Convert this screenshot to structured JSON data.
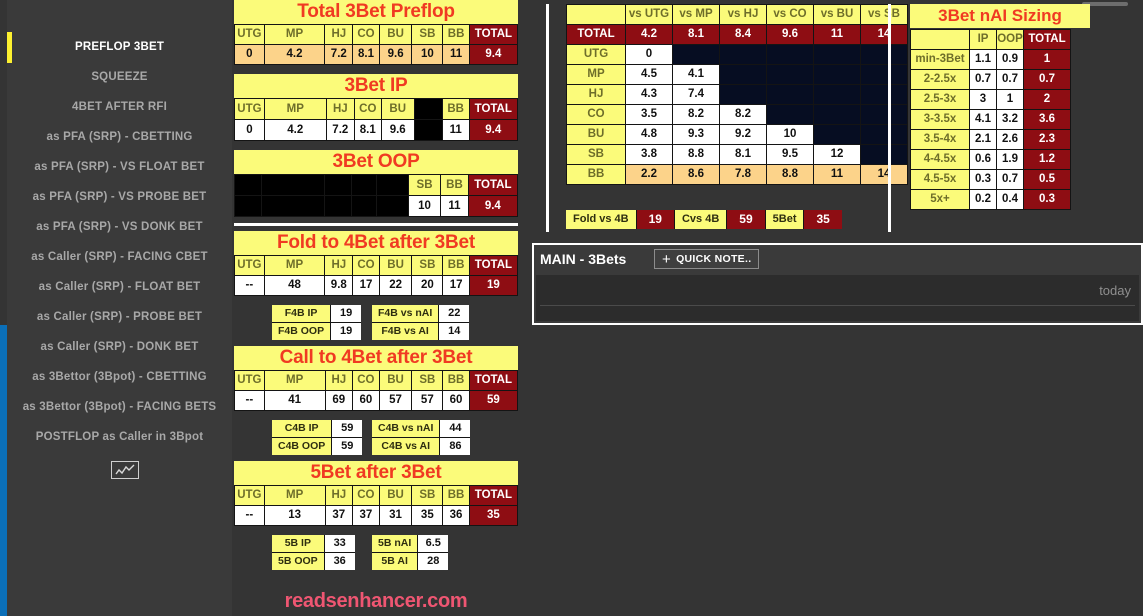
{
  "colors": {
    "accent_yellow": "#fbfb7a",
    "header_red": "#f03a22",
    "total_dark_red": "#8e0d13",
    "value_orange": "#fcd38a",
    "panel_bg": "#343434",
    "empty_navy": "#060d22",
    "brand_pink": "#ef5672",
    "sidebar_marker": "#fdf130"
  },
  "sidebar": {
    "items": [
      {
        "label": "PREFLOP 3BET",
        "active": true
      },
      {
        "label": "SQUEEZE",
        "active": false
      },
      {
        "label": "4BET AFTER RFI",
        "active": false
      },
      {
        "label": "as PFA (SRP) - CBETTING",
        "active": false
      },
      {
        "label": "as PFA (SRP) - VS FLOAT BET",
        "active": false
      },
      {
        "label": "as PFA (SRP) - VS PROBE BET",
        "active": false
      },
      {
        "label": "as PFA (SRP) - VS DONK BET",
        "active": false
      },
      {
        "label": "as Caller (SRP) - FACING CBET",
        "active": false
      },
      {
        "label": "as Caller (SRP) - FLOAT BET",
        "active": false
      },
      {
        "label": "as Caller (SRP) - PROBE BET",
        "active": false
      },
      {
        "label": "as Caller (SRP) - DONK BET",
        "active": false
      },
      {
        "label": "as 3Bettor (3Bpot) - CBETTING",
        "active": false
      },
      {
        "label": "as 3Bettor (3Bpot) - FACING BETS",
        "active": false
      },
      {
        "label": "POSTFLOP as Caller in 3Bpot",
        "active": false
      }
    ],
    "chart_icon": "line-chart-icon"
  },
  "positions": [
    "UTG",
    "MP",
    "HJ",
    "CO",
    "BU",
    "SB",
    "BB"
  ],
  "total_label": "TOTAL",
  "tables": {
    "total_3bet_preflop": {
      "title": "Total 3Bet Preflop",
      "headers": [
        "UTG",
        "MP",
        "HJ",
        "CO",
        "BU",
        "SB",
        "BB",
        "TOTAL"
      ],
      "values": [
        "0",
        "4.2",
        "7.2",
        "8.1",
        "9.6",
        "10",
        "11",
        "9.4"
      ]
    },
    "3bet_ip": {
      "title": "3Bet IP",
      "headers": [
        "UTG",
        "MP",
        "HJ",
        "CO",
        "BU",
        "",
        "BB",
        "TOTAL"
      ],
      "values": [
        "0",
        "4.2",
        "7.2",
        "8.1",
        "9.6",
        "",
        "11",
        "9.4"
      ]
    },
    "3bet_oop": {
      "title": "3Bet OOP",
      "headers": [
        "",
        "",
        "",
        "",
        "",
        "SB",
        "BB",
        "TOTAL"
      ],
      "values": [
        "",
        "",
        "",
        "",
        "",
        "10",
        "11",
        "9.4"
      ]
    },
    "fold_to_4bet": {
      "title": "Fold to 4Bet after 3Bet",
      "headers": [
        "UTG",
        "MP",
        "HJ",
        "CO",
        "BU",
        "SB",
        "BB",
        "TOTAL"
      ],
      "values": [
        "--",
        "48",
        "9.8",
        "17",
        "22",
        "20",
        "17",
        "19"
      ],
      "pills_left": [
        {
          "label": "F4B IP",
          "value": "19"
        },
        {
          "label": "F4B OOP",
          "value": "19"
        }
      ],
      "pills_right": [
        {
          "label": "F4B vs nAI",
          "value": "22"
        },
        {
          "label": "F4B vs AI",
          "value": "14"
        }
      ]
    },
    "call_to_4bet": {
      "title": "Call to 4Bet after 3Bet",
      "headers": [
        "UTG",
        "MP",
        "HJ",
        "CO",
        "BU",
        "SB",
        "BB",
        "TOTAL"
      ],
      "values": [
        "--",
        "41",
        "69",
        "60",
        "57",
        "57",
        "60",
        "59"
      ],
      "pills_left": [
        {
          "label": "C4B IP",
          "value": "59"
        },
        {
          "label": "C4B OOP",
          "value": "59"
        }
      ],
      "pills_right": [
        {
          "label": "C4B vs nAI",
          "value": "44"
        },
        {
          "label": "C4B vs AI",
          "value": "86"
        }
      ]
    },
    "5bet_after_3bet": {
      "title": "5Bet after 3Bet",
      "headers": [
        "UTG",
        "MP",
        "HJ",
        "CO",
        "BU",
        "SB",
        "BB",
        "TOTAL"
      ],
      "values": [
        "--",
        "13",
        "37",
        "37",
        "31",
        "35",
        "36",
        "35"
      ],
      "pills_left": [
        {
          "label": "5B IP",
          "value": "33"
        },
        {
          "label": "5B OOP",
          "value": "36"
        }
      ],
      "pills_right": [
        {
          "label": "5B nAI",
          "value": "6.5"
        },
        {
          "label": "5B AI",
          "value": "28"
        }
      ]
    }
  },
  "brand": "readsenhancer.com",
  "matrix": {
    "col_headers": [
      "vs UTG",
      "vs MP",
      "vs HJ",
      "vs CO",
      "vs BU",
      "vs SB"
    ],
    "total_row_label": "TOTAL",
    "total_row": [
      "4.2",
      "8.1",
      "8.4",
      "9.6",
      "11",
      "14"
    ],
    "rows": [
      {
        "label": "UTG",
        "values": [
          "0",
          "",
          "",
          "",
          "",
          ""
        ],
        "highlight": false
      },
      {
        "label": "MP",
        "values": [
          "4.5",
          "4.1",
          "",
          "",
          "",
          ""
        ],
        "highlight": false
      },
      {
        "label": "HJ",
        "values": [
          "4.3",
          "7.4",
          "",
          "",
          "",
          ""
        ],
        "highlight": false
      },
      {
        "label": "CO",
        "values": [
          "3.5",
          "8.2",
          "8.2",
          "",
          "",
          ""
        ],
        "highlight": false
      },
      {
        "label": "BU",
        "values": [
          "4.8",
          "9.3",
          "9.2",
          "10",
          "",
          ""
        ],
        "highlight": false
      },
      {
        "label": "SB",
        "values": [
          "3.8",
          "8.8",
          "8.1",
          "9.5",
          "12",
          ""
        ],
        "highlight": false
      },
      {
        "label": "BB",
        "values": [
          "2.2",
          "8.6",
          "7.8",
          "8.8",
          "11",
          "14"
        ],
        "highlight": true
      }
    ],
    "summary": [
      {
        "label": "Fold vs 4B",
        "value": "19"
      },
      {
        "label": "Cvs 4B",
        "value": "59"
      },
      {
        "label": "5Bet",
        "value": "35"
      }
    ]
  },
  "sizing": {
    "title": "3Bet nAI Sizing",
    "headers": [
      "",
      "IP",
      "OOP",
      "TOTAL"
    ],
    "rows": [
      {
        "label": "min-3Bet",
        "ip": "1.1",
        "oop": "0.9",
        "total": "1"
      },
      {
        "label": "2-2.5x",
        "ip": "0.7",
        "oop": "0.7",
        "total": "0.7"
      },
      {
        "label": "2.5-3x",
        "ip": "3",
        "oop": "1",
        "total": "2"
      },
      {
        "label": "3-3.5x",
        "ip": "4.1",
        "oop": "3.2",
        "total": "3.6"
      },
      {
        "label": "3.5-4x",
        "ip": "2.1",
        "oop": "2.6",
        "total": "2.3"
      },
      {
        "label": "4-4.5x",
        "ip": "0.6",
        "oop": "1.9",
        "total": "1.2"
      },
      {
        "label": "4.5-5x",
        "ip": "0.3",
        "oop": "0.7",
        "total": "0.5"
      },
      {
        "label": "5x+",
        "ip": "0.2",
        "oop": "0.4",
        "total": "0.3"
      }
    ]
  },
  "notes": {
    "title": "MAIN - 3Bets",
    "quick_note_button": "QUICK NOTE..",
    "date": "today",
    "body_text": ""
  }
}
